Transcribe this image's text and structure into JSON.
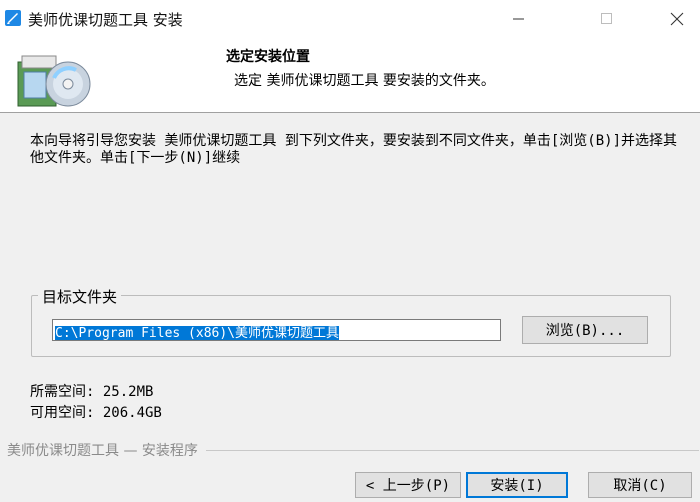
{
  "window": {
    "title": "美师优课切题工具 安装"
  },
  "header": {
    "title": "选定安装位置",
    "subtitle": "选定 美师优课切题工具 要安装的文件夹。"
  },
  "body": {
    "intro": "本向导将引导您安装 美师优课切题工具 到下列文件夹，要安装到不同文件夹，单击[浏览(B)]并选择其他文件夹。单击[下一步(N)]继续",
    "destination_group_label": "目标文件夹",
    "destination_path": "C:\\Program Files (x86)\\美师优课切题工具",
    "browse_label": "浏览(B)...",
    "space_required": "所需空间: 25.2MB",
    "space_available": "可用空间: 206.4GB"
  },
  "footer": {
    "branding": "美师优课切题工具 — 安装程序",
    "back_label": "< 上一步(P)",
    "install_label": "安装(I)",
    "cancel_label": "取消(C)"
  },
  "colors": {
    "accent": "#0078d7",
    "background": "#f0f0f0"
  },
  "icons": [
    "installer-app-icon",
    "minimize-icon",
    "maximize-icon",
    "close-icon",
    "installer-disc-box-icon"
  ]
}
